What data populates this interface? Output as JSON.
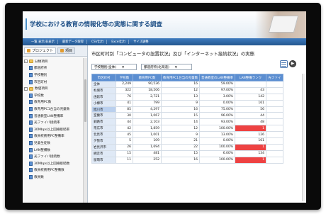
{
  "header": {
    "title": "学校における教育の情報化等の実態に関する調査"
  },
  "menu": {
    "items": [
      "一覧 表示/非表示",
      "最新データ取得",
      "CSV出力",
      "Excel出力",
      "サイズ調整"
    ]
  },
  "sidebar": {
    "tabs": [
      {
        "label": "プロジェクト"
      },
      {
        "label": "項目"
      }
    ],
    "tree": [
      {
        "label": "分類項目",
        "type": "folder",
        "toggle": "-",
        "level": 1
      },
      {
        "label": "都道府県",
        "type": "doc",
        "level": 2
      },
      {
        "label": "学校種別",
        "type": "doc",
        "level": 2
      },
      {
        "label": "市区町村",
        "type": "doc",
        "level": 2
      },
      {
        "label": "数値項目",
        "type": "folder",
        "toggle": "-",
        "level": 1
      },
      {
        "label": "学校数",
        "type": "doc",
        "level": 2
      },
      {
        "label": "教育用PC数",
        "type": "doc",
        "level": 2
      },
      {
        "label": "教育用PC1台当の児童数",
        "type": "doc",
        "level": 2
      },
      {
        "label": "普通教室LAN整備率",
        "type": "doc",
        "level": 2
      },
      {
        "label": "光ファイバ接続率",
        "type": "doc",
        "level": 2
      },
      {
        "label": "30Mbps以上回線接続率",
        "type": "doc",
        "level": 2
      },
      {
        "label": "教員校務用PC整備率",
        "type": "doc",
        "level": 2
      },
      {
        "label": "児童生徒数",
        "type": "doc",
        "level": 2
      },
      {
        "label": "LAN整備数",
        "type": "doc",
        "level": 2
      },
      {
        "label": "光ファイバ接続数",
        "type": "doc",
        "level": 2
      },
      {
        "label": "30Mbps以上回線接続数",
        "type": "doc",
        "level": 2
      },
      {
        "label": "教員校務用PC整備数",
        "type": "doc",
        "level": 2
      },
      {
        "label": "教員数",
        "type": "doc",
        "level": 2
      }
    ]
  },
  "main": {
    "title": "市区町村別「コンピュータの設置状況」及び「インターネット接続状況」の実態",
    "selects": [
      {
        "value": "学校種別(全体)"
      },
      {
        "value": "都道府県(北海道)"
      }
    ],
    "table": {
      "columns": [
        "市区町村",
        "学校数",
        "教育用PC数",
        "教育用PC1台当の児童数",
        "普通教室のLAN整備率",
        "LAN整備ランク",
        "光ファイ"
      ],
      "rows": [
        {
          "name": "全体",
          "v": [
            "2,249",
            "90,536",
            "16",
            "59.00%",
            "",
            ""
          ],
          "red": false
        },
        {
          "name": "札幌市",
          "v": [
            "322",
            "18,506",
            "12",
            "97.00%",
            "43",
            ""
          ],
          "red": false
        },
        {
          "name": "函館市",
          "v": [
            "76",
            "2,721",
            "13",
            "3.00%",
            "142",
            ""
          ],
          "red": false
        },
        {
          "name": "小樽市",
          "v": [
            "41",
            "799",
            "9",
            "0.00%",
            "161",
            ""
          ],
          "red": false
        },
        {
          "name": "旭川市",
          "v": [
            "85",
            "4,297",
            "16",
            "75.00%",
            "56",
            ""
          ],
          "red": false
        },
        {
          "name": "室蘭市",
          "v": [
            "30",
            "1,067",
            "15",
            "96.00%",
            "44",
            ""
          ],
          "red": false
        },
        {
          "name": "釧路市",
          "v": [
            "44",
            "2,103",
            "14",
            "93.00%",
            "48",
            ""
          ],
          "red": false
        },
        {
          "name": "帯広市",
          "v": [
            "42",
            "1,859",
            "12",
            "100.00%",
            "1",
            ""
          ],
          "red": true
        },
        {
          "name": "北見市",
          "v": [
            "45",
            "1,001",
            "9",
            "13.00%",
            "126",
            ""
          ],
          "red": false
        },
        {
          "name": "夕張市",
          "v": [
            "5",
            "109",
            "21",
            "0.00%",
            "161",
            ""
          ],
          "red": false
        },
        {
          "name": "岩見沢市",
          "v": [
            "26",
            "1,694",
            "22",
            "100.00%",
            "1",
            ""
          ],
          "red": true
        },
        {
          "name": "網走市",
          "v": [
            "15",
            "481",
            "15",
            "6.00%",
            "134",
            ""
          ],
          "red": false
        },
        {
          "name": "留萌市",
          "v": [
            "11",
            "252",
            "16",
            "100.00%",
            "1",
            ""
          ],
          "red": true
        }
      ]
    }
  }
}
